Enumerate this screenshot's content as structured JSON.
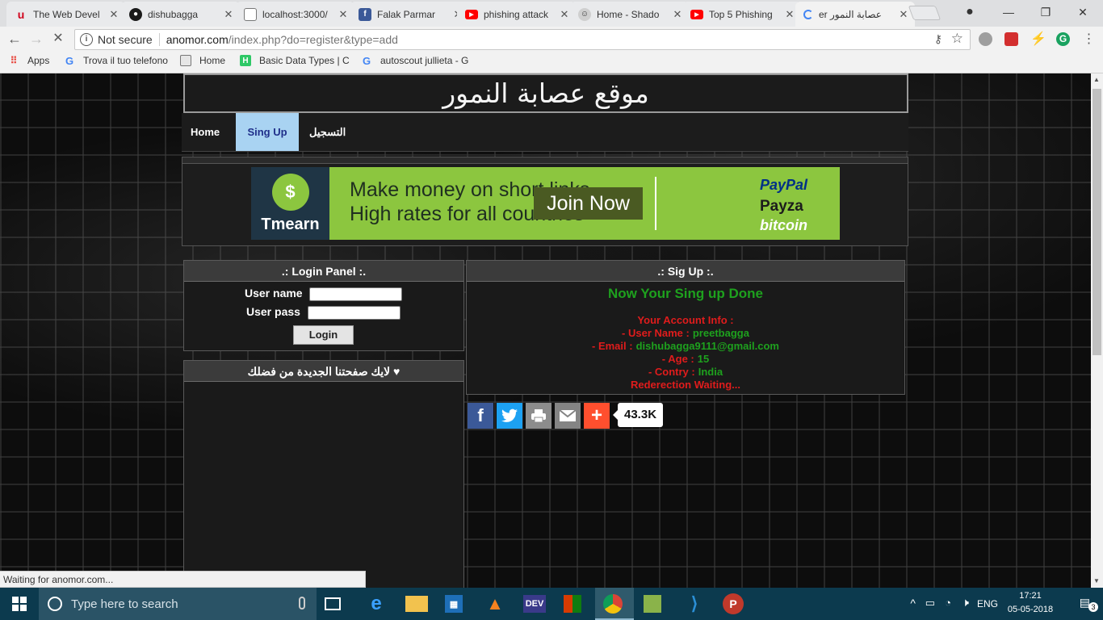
{
  "browser": {
    "tabs": [
      {
        "title": "The Web Devel",
        "icon": "webdev-icon",
        "color": "#d0021b"
      },
      {
        "title": "dishubagga",
        "icon": "github-icon",
        "color": "#1a1a1a"
      },
      {
        "title": "localhost:3000/",
        "icon": "page-icon",
        "color": "#ffffff"
      },
      {
        "title": "Falak Parmar",
        "icon": "facebook-icon",
        "color": "#3b5998"
      },
      {
        "title": "phishing attack",
        "icon": "youtube-icon",
        "color": "#ff0000"
      },
      {
        "title": "Home - Shado",
        "icon": "mask-icon",
        "color": "#666666"
      },
      {
        "title": "Top 5 Phishing",
        "icon": "youtube-icon",
        "color": "#ff0000"
      },
      {
        "title": "er عصابة النمور",
        "icon": "loading-icon",
        "color": "#4285f4"
      }
    ],
    "url_secure_label": "Not secure",
    "url_host": "anomor.com",
    "url_path": "/index.php?do=register&type=add",
    "bookmarks": [
      {
        "label": "Apps",
        "icon": "apps-grid-icon"
      },
      {
        "label": "Trova il tuo telefono",
        "icon": "google-icon"
      },
      {
        "label": "Home",
        "icon": "page-icon"
      },
      {
        "label": "Basic Data Types | C",
        "icon": "hackerrank-icon"
      },
      {
        "label": "autoscout jullieta - G",
        "icon": "google-icon"
      }
    ],
    "status_text": "Waiting for anomor.com..."
  },
  "site": {
    "title": "موقع عصابة النمور",
    "nav": [
      {
        "label": "Home",
        "active": false
      },
      {
        "label": "Sing Up",
        "active": true
      },
      {
        "label": "التسجيل",
        "active": false
      }
    ],
    "ad": {
      "brand": "Tmearn",
      "line1": "Make money on short links",
      "line2": "High rates for all countries",
      "cta": "Join Now",
      "payments": [
        "PayPal",
        "Payza",
        "bitcoin"
      ]
    },
    "login_panel": {
      "title": ".: Login Panel :.",
      "username_label": "User name",
      "password_label": "User pass",
      "button_label": "Login"
    },
    "like_panel": {
      "title": "♥ لايك صفحتنا الجديدة من فضلك"
    },
    "signup_panel": {
      "title": ".: Sig Up :.",
      "message": "Now Your Sing up Done",
      "info_heading": "Your Account Info :",
      "fields": [
        {
          "label": "- User Name :",
          "value": "preetbagga"
        },
        {
          "label": "- Email :",
          "value": "dishubagga9111@gmail.com"
        },
        {
          "label": "- Age :",
          "value": "15"
        },
        {
          "label": "- Contry :",
          "value": "India"
        }
      ],
      "redirect_text": "Rederection Waiting..."
    },
    "share": {
      "buttons": [
        {
          "name": "facebook-share",
          "color": "#3b5998"
        },
        {
          "name": "twitter-share",
          "color": "#1da1f2"
        },
        {
          "name": "print-share",
          "color": "#8c8c8c"
        },
        {
          "name": "email-share",
          "color": "#848484"
        },
        {
          "name": "more-share",
          "color": "#ff4f2e"
        }
      ],
      "count": "43.3K"
    }
  },
  "taskbar": {
    "search_placeholder": "Type here to search",
    "language": "ENG",
    "time": "17:21",
    "date": "05-05-2018",
    "notification_count": "3"
  }
}
